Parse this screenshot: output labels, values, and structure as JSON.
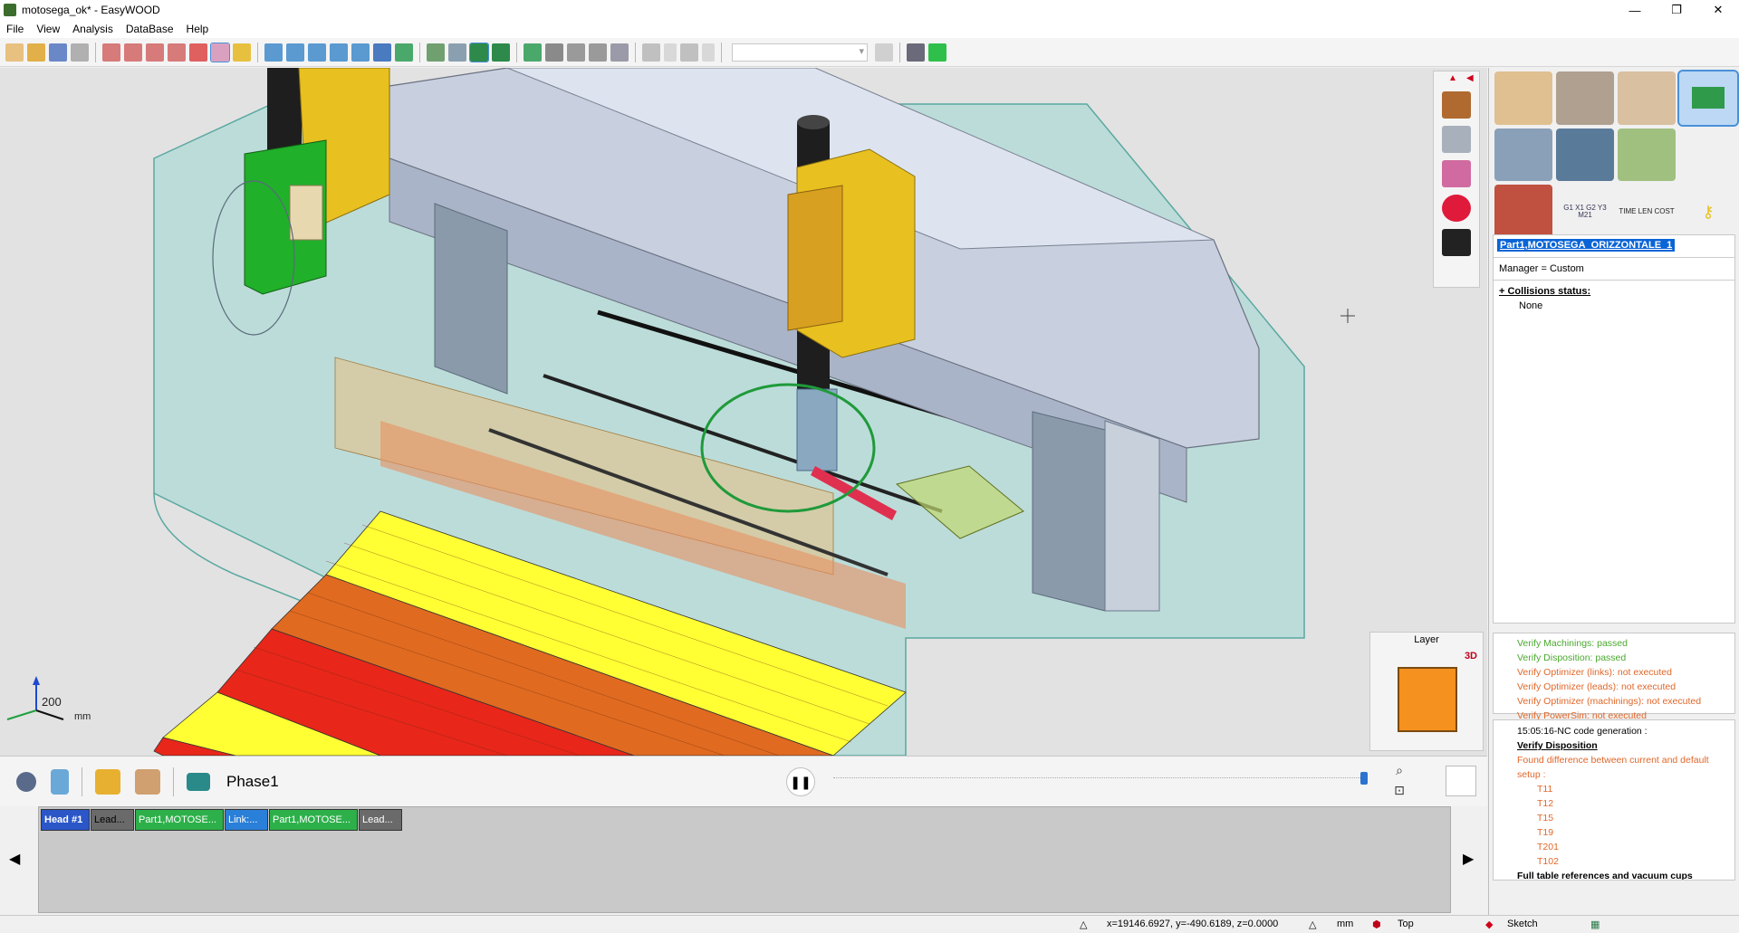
{
  "window": {
    "title": "motosega_ok* - EasyWOOD",
    "minimize": "—",
    "maximize": "❐",
    "close": "✕"
  },
  "menu": [
    "File",
    "View",
    "Analysis",
    "DataBase",
    "Help"
  ],
  "viewport": {
    "scale_value": "200",
    "scale_unit": "mm"
  },
  "layer_panel": {
    "title": "Layer",
    "mode": "3D"
  },
  "icon_grid": [
    {
      "name": "pencil-tool-icon"
    },
    {
      "name": "drill-tool-icon"
    },
    {
      "name": "panel-tool-icon"
    },
    {
      "name": "machine-tool-icon",
      "selected": true
    },
    {
      "name": "gear-tool-icon"
    },
    {
      "name": "panel-blue-icon"
    },
    {
      "name": "cash-icon"
    },
    {
      "name": "empty"
    },
    {
      "name": "box-icon"
    },
    {
      "name": "gcode-icon",
      "label": "G1 X1 G2 Y3 M21"
    },
    {
      "name": "time-cost-icon",
      "label": "TIME LEN COST"
    },
    {
      "name": "key-icon"
    }
  ],
  "info": {
    "part_name": "Part1,MOTOSEGA_ORIZZONTALE_1",
    "manager": "Manager = Custom",
    "collisions_label": "+ Collisions status:",
    "collisions_value": "None"
  },
  "verify": [
    {
      "text": "Verify Machinings: passed",
      "status": "ok"
    },
    {
      "text": "Verify Disposition: passed",
      "status": "ok"
    },
    {
      "text": "Verify Optimizer (links): not executed",
      "status": "warn"
    },
    {
      "text": "Verify Optimizer (leads): not executed",
      "status": "warn"
    },
    {
      "text": "Verify Optimizer (machinings): not executed",
      "status": "warn"
    },
    {
      "text": "Verify PowerSim: not executed",
      "status": "warn"
    }
  ],
  "log": {
    "header": "15:05:16-NC code generation :",
    "verify_disposition": "Verify Disposition",
    "found_diff": "Found difference between current and default setup :",
    "tools": [
      "T11",
      "T12",
      "T15",
      "T19",
      "T201",
      "T102"
    ],
    "footer": "Full table references and vacuum cups"
  },
  "phase": {
    "label": "Phase1",
    "pause": "❚❚"
  },
  "sequence": [
    {
      "label": "Head #1",
      "color": "#2a56c8",
      "text_color": "#ffffff"
    },
    {
      "label": "Lead...",
      "color": "#6a6a6a",
      "text_color": "#000000"
    },
    {
      "label": "Part1,MOTOSE...",
      "color": "#2db04a",
      "text_color": "#ffffff"
    },
    {
      "label": "Link:...",
      "color": "#2a7fd8",
      "text_color": "#ffffff"
    },
    {
      "label": "Part1,MOTOSE...",
      "color": "#2db04a",
      "text_color": "#ffffff"
    },
    {
      "label": "Lead...",
      "color": "#6a6a6a",
      "text_color": "#ffffff"
    }
  ],
  "status": {
    "coords": "x=19146.6927, y=-490.6189, z=0.0000",
    "unit": "mm",
    "view": "Top",
    "mode": "Sketch"
  }
}
